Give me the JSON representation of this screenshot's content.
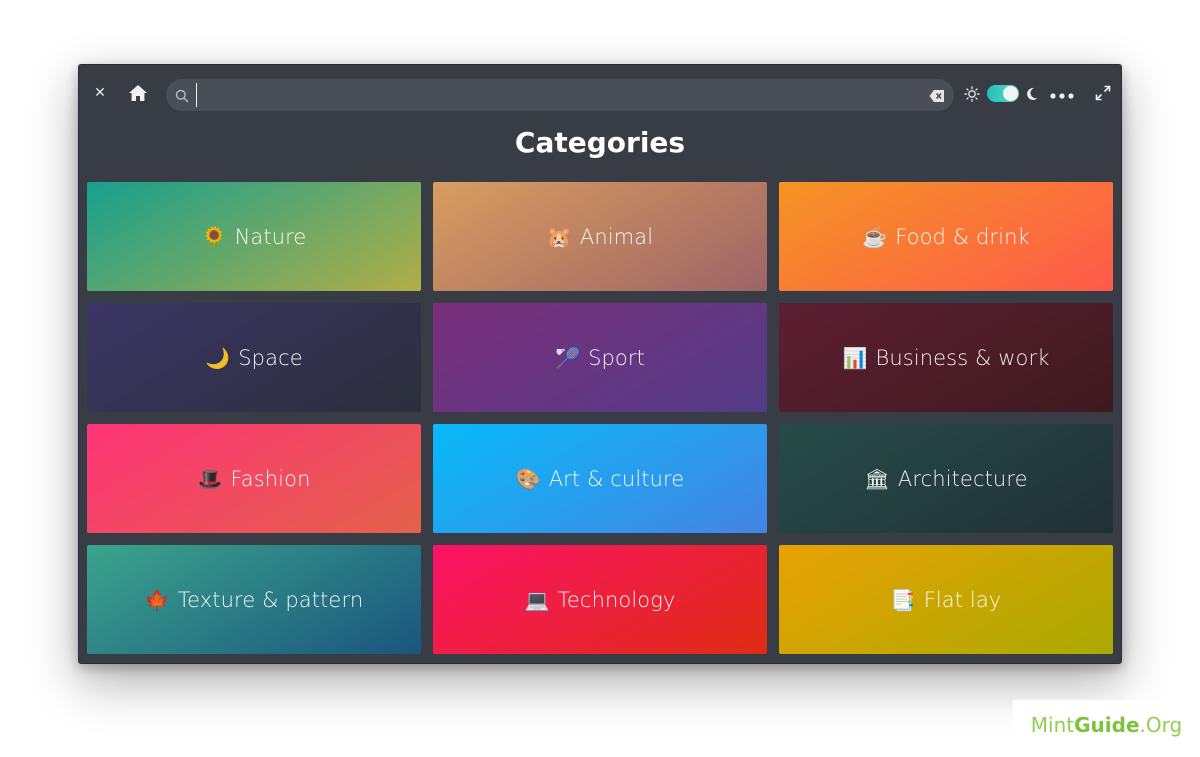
{
  "header": {
    "search_placeholder": "",
    "icons": [
      "close-icon",
      "home-icon",
      "search-icon",
      "clear-icon",
      "sun-icon",
      "theme-toggle",
      "moon-icon",
      "more-icon",
      "expand-icon"
    ],
    "toggle_accent": "#21c0b9"
  },
  "page": {
    "title": "Categories"
  },
  "categories": [
    {
      "emoji": "🌻",
      "label": "Nature"
    },
    {
      "emoji": "🐹",
      "label": "Animal"
    },
    {
      "emoji": "☕",
      "label": "Food & drink"
    },
    {
      "emoji": "🌙",
      "label": "Space"
    },
    {
      "emoji": "🏸",
      "label": "Sport"
    },
    {
      "emoji": "📊",
      "label": "Business & work"
    },
    {
      "emoji": "🎩",
      "label": "Fashion"
    },
    {
      "emoji": "🎨",
      "label": "Art & culture"
    },
    {
      "emoji": "🏛",
      "label": "Architecture"
    },
    {
      "emoji": "🍁",
      "label": "Texture & pattern"
    },
    {
      "emoji": "💻",
      "label": "Technology"
    },
    {
      "emoji": "📑",
      "label": "Flat lay"
    }
  ],
  "colors": {
    "window_bg": "#383c44",
    "tiles": [
      [
        "#17a08e",
        "#b2ae46"
      ],
      [
        "#d89d5f",
        "#9e6466"
      ],
      [
        "#f59423",
        "#fe5a4b"
      ],
      [
        "#3a3565",
        "#2c2f3b"
      ],
      [
        "#7b2f7c",
        "#523c87"
      ],
      [
        "#5e1f32",
        "#3d1a1e"
      ],
      [
        "#fe3477",
        "#e3614a"
      ],
      [
        "#08baf9",
        "#4484e3"
      ],
      [
        "#264c48",
        "#223036"
      ],
      [
        "#3ba48c",
        "#1a557e"
      ],
      [
        "#fd1367",
        "#dd2c12"
      ],
      [
        "#e9a103",
        "#aaaa02"
      ]
    ]
  },
  "watermark": {
    "part1": "Mint",
    "part2": "Guide",
    "part3": ".Org"
  }
}
